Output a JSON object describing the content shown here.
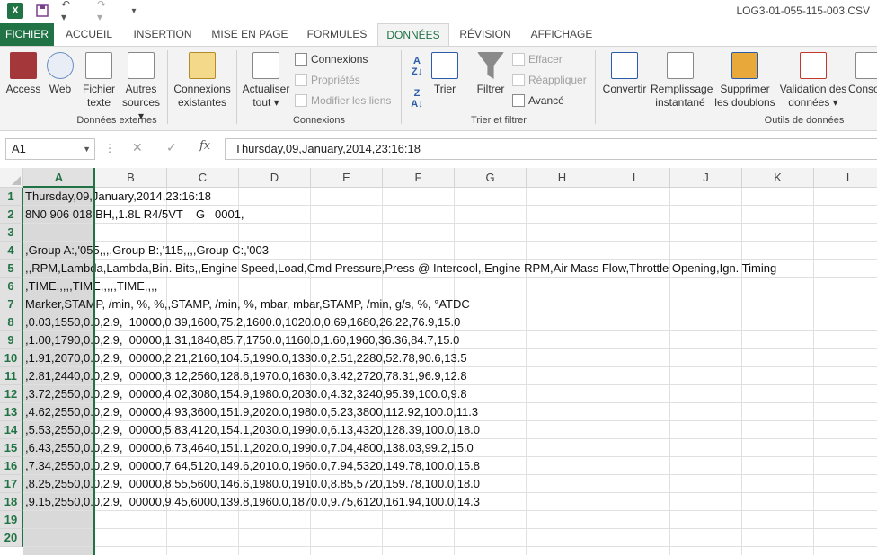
{
  "titlebar": {
    "app_icon": "X",
    "title": "LOG3-01-055-115-003.CSV",
    "icons": [
      "excel-icon",
      "save-icon",
      "undo-icon",
      "redo-icon",
      "customize-qat-icon"
    ]
  },
  "tabs": [
    "FICHIER",
    "ACCUEIL",
    "INSERTION",
    "MISE EN PAGE",
    "FORMULES",
    "DONNÉES",
    "RÉVISION",
    "AFFICHAGE"
  ],
  "ribbon": {
    "ext": {
      "access": "Access",
      "web": "Web",
      "text1": "Fichier",
      "text2": "texte",
      "other1": "Autres",
      "other2": "sources ▾",
      "label": "Données externes"
    },
    "conn": {
      "existing1": "Connexions",
      "existing2": "existantes",
      "refresh1": "Actualiser",
      "refresh2": "tout ▾",
      "connections": "Connexions",
      "properties": "Propriétés",
      "edit_links": "Modifier les liens",
      "label": "Connexions"
    },
    "sort": {
      "sort": "Trier",
      "filter": "Filtrer",
      "clear": "Effacer",
      "reapply": "Réappliquer",
      "advanced": "Avancé",
      "label": "Trier et filtrer"
    },
    "tools": {
      "convert": "Convertir",
      "flash1": "Remplissage",
      "flash2": "instantané",
      "dups1": "Supprimer",
      "dups2": "les doublons",
      "valid1": "Validation des",
      "valid2": "données ▾",
      "cons": "Conso",
      "label": "Outils de données"
    }
  },
  "formula_bar": {
    "name_box": "A1",
    "formula": "Thursday,09,January,2014,23:16:18"
  },
  "columns": [
    "A",
    "B",
    "C",
    "D",
    "E",
    "F",
    "G",
    "H",
    "I",
    "J",
    "K",
    "L"
  ],
  "rows": [
    {
      "n": "1",
      "v": "Thursday,09,January,2014,23:16:18"
    },
    {
      "n": "2",
      "v": "8N0 906 018 BH,,1.8L R4/5VT    G   0001,"
    },
    {
      "n": "3",
      "v": ""
    },
    {
      "n": "4",
      "v": ",Group A:,'055,,,,Group B:,'115,,,,Group C:,'003"
    },
    {
      "n": "5",
      "v": ",,RPM,Lambda,Lambda,Bin. Bits,,Engine Speed,Load,Cmd Pressure,Press @ Intercool,,Engine RPM,Air Mass Flow,Throttle Opening,Ign. Timing"
    },
    {
      "n": "6",
      "v": ",TIME,,,,,TIME,,,,,TIME,,,,"
    },
    {
      "n": "7",
      "v": "Marker,STAMP, /min, %, %,,STAMP, /min, %, mbar, mbar,STAMP, /min, g/s, %, °ATDC"
    },
    {
      "n": "8",
      "v": ",0.03,1550,0.0,2.9,  10000,0.39,1600,75.2,1600.0,1020.0,0.69,1680,26.22,76.9,15.0"
    },
    {
      "n": "9",
      "v": ",1.00,1790,0.0,2.9,  00000,1.31,1840,85.7,1750.0,1160.0,1.60,1960,36.36,84.7,15.0"
    },
    {
      "n": "10",
      "v": ",1.91,2070,0.0,2.9,  00000,2.21,2160,104.5,1990.0,1330.0,2.51,2280,52.78,90.6,13.5"
    },
    {
      "n": "11",
      "v": ",2.81,2440,0.0,2.9,  00000,3.12,2560,128.6,1970.0,1630.0,3.42,2720,78.31,96.9,12.8"
    },
    {
      "n": "12",
      "v": ",3.72,2550,0.0,2.9,  00000,4.02,3080,154.9,1980.0,2030.0,4.32,3240,95.39,100.0,9.8"
    },
    {
      "n": "13",
      "v": ",4.62,2550,0.0,2.9,  00000,4.93,3600,151.9,2020.0,1980.0,5.23,3800,112.92,100.0,11.3"
    },
    {
      "n": "14",
      "v": ",5.53,2550,0.0,2.9,  00000,5.83,4120,154.1,2030.0,1990.0,6.13,4320,128.39,100.0,18.0"
    },
    {
      "n": "15",
      "v": ",6.43,2550,0.0,2.9,  00000,6.73,4640,151.1,2020.0,1990.0,7.04,4800,138.03,99.2,15.0"
    },
    {
      "n": "16",
      "v": ",7.34,2550,0.0,2.9,  00000,7.64,5120,149.6,2010.0,1960.0,7.94,5320,149.78,100.0,15.8"
    },
    {
      "n": "17",
      "v": ",8.25,2550,0.0,2.9,  00000,8.55,5600,146.6,1980.0,1910.0,8.85,5720,159.78,100.0,18.0"
    },
    {
      "n": "18",
      "v": ",9.15,2550,0.0,2.9,  00000,9.45,6000,139.8,1960.0,1870.0,9.75,6120,161.94,100.0,14.3"
    },
    {
      "n": "19",
      "v": ""
    },
    {
      "n": "20",
      "v": ""
    }
  ],
  "colors": {
    "accent": "#217346",
    "ribbon_bg": "#f3f3f3",
    "header_bg": "#f3f3f3",
    "selected_header": "#e1e1e1"
  }
}
